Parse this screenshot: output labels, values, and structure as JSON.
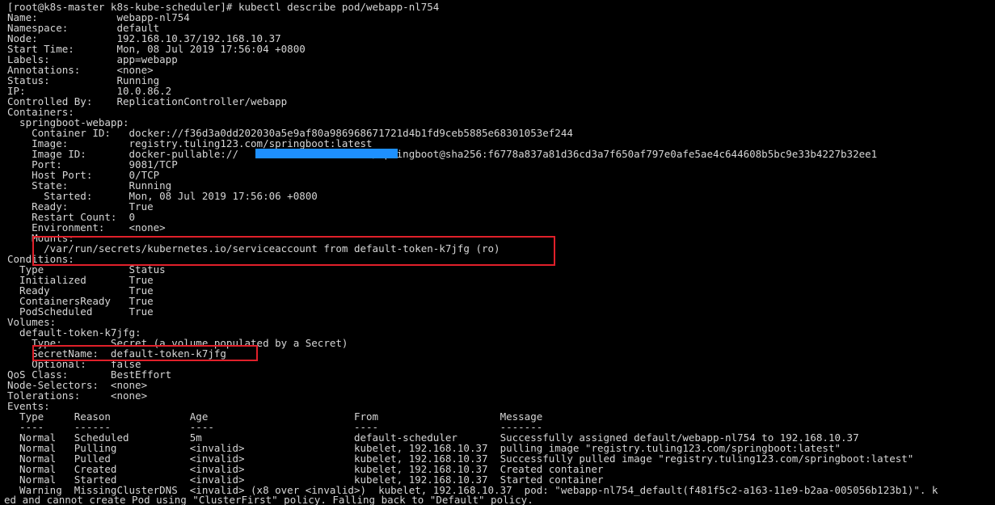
{
  "terminal": {
    "lines": [
      "[root@k8s-master k8s-kube-scheduler]# kubectl describe pod/webapp-nl754",
      "Name:             webapp-nl754",
      "Namespace:        default",
      "Node:             192.168.10.37/192.168.10.37",
      "Start Time:       Mon, 08 Jul 2019 17:56:04 +0800",
      "Labels:           app=webapp",
      "Annotations:      <none>",
      "Status:           Running",
      "IP:               10.0.86.2",
      "Controlled By:    ReplicationController/webapp",
      "Containers:",
      "  springboot-webapp:",
      "    Container ID:   docker://f36d3a0dd202030a5e9af80a986968671721d4b1fd9ceb5885e68301053ef244",
      "    Image:          registry.tuling123.com/springboot:latest",
      "    Image ID:       docker-pullable://                      /springboot@sha256:f6778a837a81d36cd3a7f650af797e0afe5ae4c644608b5bc9e33b4227b32ee1",
      "    Port:           9081/TCP",
      "    Host Port:      0/TCP",
      "    State:          Running",
      "      Started:      Mon, 08 Jul 2019 17:56:06 +0800",
      "    Ready:          True",
      "    Restart Count:  0",
      "    Environment:    <none>",
      "    Mounts:",
      "      /var/run/secrets/kubernetes.io/serviceaccount from default-token-k7jfg (ro)",
      "Conditions:",
      "  Type              Status",
      "  Initialized       True",
      "  Ready             True",
      "  ContainersReady   True",
      "  PodScheduled      True",
      "Volumes:",
      "  default-token-k7jfg:",
      "    Type:        Secret (a volume populated by a Secret)",
      "    SecretName:  default-token-k7jfg",
      "    Optional:    false",
      "QoS Class:       BestEffort",
      "Node-Selectors:  <none>",
      "Tolerations:     <none>",
      "Events:",
      "  Type     Reason             Age                        From                    Message",
      "  ----     ------             ----                       ----                    -------",
      "  Normal   Scheduled          5m                         default-scheduler       Successfully assigned default/webapp-nl754 to 192.168.10.37",
      "  Normal   Pulling            <invalid>                  kubelet, 192.168.10.37  pulling image \"registry.tuling123.com/springboot:latest\"",
      "  Normal   Pulled             <invalid>                  kubelet, 192.168.10.37  Successfully pulled image \"registry.tuling123.com/springboot:latest\"",
      "  Normal   Created            <invalid>                  kubelet, 192.168.10.37  Created container",
      "  Normal   Started            <invalid>                  kubelet, 192.168.10.37  Started container",
      "  Warning  MissingClusterDNS  <invalid> (x8 over <invalid>)  kubelet, 192.168.10.37  pod: \"webapp-nl754_default(f481f5c2-a163-11e9-b2aa-005056b123b1)\". k",
      "ed and cannot create Pod using \"ClusterFirst\" policy. Falling back to \"Default\" policy."
    ]
  },
  "highlight_color": "#e0202a",
  "redaction_color": "#1e90ff",
  "text_color": "#d6d6d6",
  "background_color": "#000000"
}
